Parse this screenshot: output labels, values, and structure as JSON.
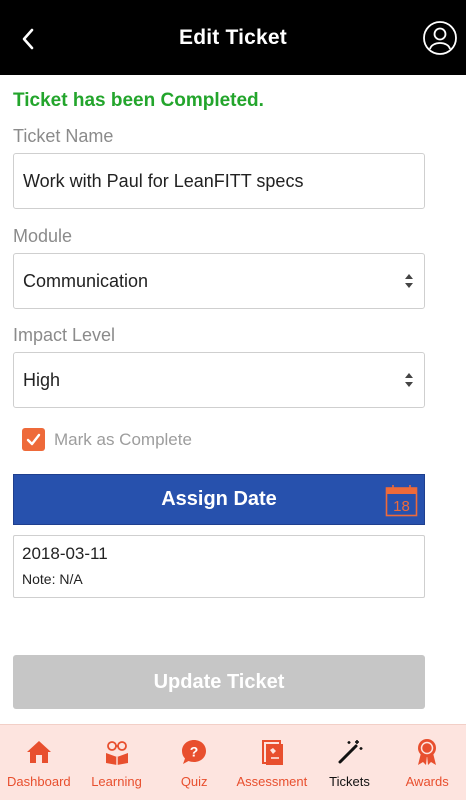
{
  "header": {
    "title": "Edit Ticket",
    "back_icon": "chevron-left-icon",
    "profile_icon": "user-circle-icon"
  },
  "status": {
    "message": "Ticket has been Completed.",
    "color": "#23a52c"
  },
  "form": {
    "ticket_name_label": "Ticket Name",
    "ticket_name_value": "Work with Paul for LeanFITT specs",
    "module_label": "Module",
    "module_value": "Communication",
    "impact_label": "Impact Level",
    "impact_value": "High",
    "mark_complete_label": "Mark as Complete",
    "mark_complete_checked": true
  },
  "assign": {
    "label": "Assign Date",
    "calendar_day": "18",
    "color": "#2751ad"
  },
  "date_info": {
    "date": "2018-03-11",
    "note": "Note: N/A"
  },
  "update": {
    "label": "Update Ticket"
  },
  "tabs": [
    {
      "label": "Dashboard",
      "icon": "home-icon"
    },
    {
      "label": "Learning",
      "icon": "learning-icon"
    },
    {
      "label": "Quiz",
      "icon": "quiz-icon"
    },
    {
      "label": "Assessment",
      "icon": "assessment-icon"
    },
    {
      "label": "Tickets",
      "icon": "magic-wand-icon",
      "active": true
    },
    {
      "label": "Awards",
      "icon": "award-ribbon-icon"
    }
  ],
  "colors": {
    "accent": "#e84f2e",
    "checkbox": "#ee6a3a",
    "tabbar_bg": "#fde4df"
  }
}
